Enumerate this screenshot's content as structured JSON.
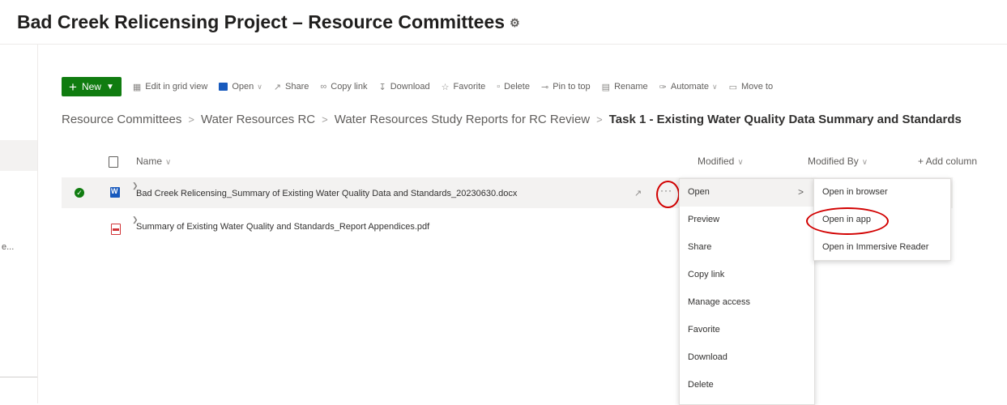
{
  "page": {
    "title": "Bad Creek Relicensing Project – Resource Committees"
  },
  "icons": {
    "settings": "settings-icon",
    "new": "plus-icon",
    "grid": "grid-icon",
    "word": "word-icon",
    "share": "share-icon",
    "link": "link-icon",
    "download": "download-icon",
    "favorite": "star-icon",
    "delete": "trash-icon",
    "pin": "pin-icon",
    "rename": "rename-icon",
    "automate": "automate-icon",
    "move": "move-icon"
  },
  "colors": {
    "new_button": "#107c10",
    "annotation": "#d20000",
    "word": "#185abd",
    "pdf": "#d13438"
  },
  "command_bar": {
    "new_label": "New",
    "edit_grid": "Edit in grid view",
    "open": "Open",
    "share": "Share",
    "copy_link": "Copy link",
    "download": "Download",
    "favorite": "Favorite",
    "delete": "Delete",
    "pin_to_top": "Pin to top",
    "rename": "Rename",
    "automate": "Automate",
    "move_to": "Move to"
  },
  "breadcrumb": {
    "items": [
      "Resource Committees",
      "Water Resources RC",
      "Water Resources Study Reports for RC Review"
    ],
    "current": "Task 1 - Existing Water Quality Data Summary and Standards",
    "separator": ">"
  },
  "columns": {
    "name": "Name",
    "modified": "Modified",
    "modified_by": "Modified By",
    "add_column": "+ Add column"
  },
  "files": [
    {
      "name": "Bad Creek Relicensing_Summary of Existing Water Quality Data and Standards_20230630.docx"
    },
    {
      "name": "Summary of Existing Water Quality and Standards_Report Appendices.pdf"
    }
  ],
  "context_menu": {
    "items": [
      "Open",
      "Preview",
      "Share",
      "Copy link",
      "Manage access",
      "Favorite",
      "Download",
      "Delete"
    ],
    "chevron": ">"
  },
  "open_submenu": {
    "items": [
      "Open in browser",
      "Open in app",
      "Open in Immersive Reader"
    ]
  },
  "left_rail": {
    "truncated_text": "e..."
  }
}
